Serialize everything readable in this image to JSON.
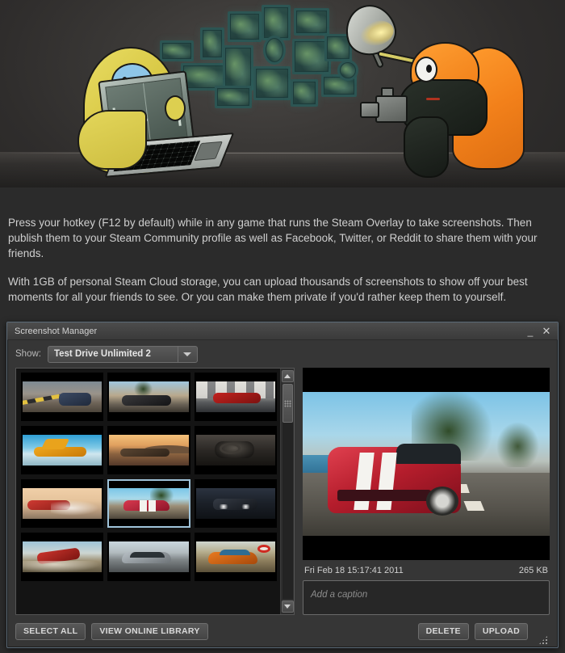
{
  "page": {
    "body_paragraphs": [
      "Press your hotkey (F12 by default) while in any game that runs the Steam Overlay to take screenshots. Then publish them to your Steam Community profile as well as Facebook, Twitter, or Reddit to share them with your friends.",
      "With 1GB of personal Steam Cloud storage, you can upload thousands of screenshots to show off your best moments for all your friends to see. Or you can make them private if you'd rather keep them to yourself."
    ]
  },
  "hero": {
    "alt": "Two blob characters: a yellow one with a laptop and an orange one with a camera and studio light, surrounded by floating picture frames"
  },
  "window": {
    "title": "Screenshot Manager",
    "minimize_label": "_",
    "close_label": "✕",
    "toolbar": {
      "show_label": "Show:",
      "selected_game": "Test Drive Unlimited 2"
    },
    "thumbnails": [
      {
        "id": 1,
        "alt": "Blue sports car on desert road",
        "selected": false
      },
      {
        "id": 2,
        "alt": "Black sports car with palm trees",
        "selected": false
      },
      {
        "id": 3,
        "alt": "Red coupe in front of building",
        "selected": false
      },
      {
        "id": 4,
        "alt": "Orange supercar with doors up",
        "selected": false
      },
      {
        "id": 5,
        "alt": "Convertible at sunset in desert",
        "selected": false
      },
      {
        "id": 6,
        "alt": "Car interior dashboard view",
        "selected": false
      },
      {
        "id": 7,
        "alt": "Red car drifting in dust",
        "selected": false
      },
      {
        "id": 8,
        "alt": "Red Viper with white stripes on coast road",
        "selected": true
      },
      {
        "id": 9,
        "alt": "Dark car with headlights at night",
        "selected": false
      },
      {
        "id": 10,
        "alt": "Red car jumping off road",
        "selected": false
      },
      {
        "id": 11,
        "alt": "Silver coupe on highway",
        "selected": false
      },
      {
        "id": 12,
        "alt": "Orange supercar near road sign",
        "selected": false
      }
    ],
    "scrollbar": {
      "up_arrow": "▲",
      "down_arrow": "▼"
    },
    "preview": {
      "alt": "Red Dodge Viper with white racing stripes driving on a coastal road",
      "timestamp": "Fri Feb 18 15:17:41 2011",
      "file_size": "265 KB",
      "caption_placeholder": "Add a caption",
      "caption_value": ""
    },
    "footer": {
      "select_all_label": "SELECT ALL",
      "view_online_library_label": "VIEW ONLINE LIBRARY",
      "delete_label": "DELETE",
      "upload_label": "UPLOAD"
    }
  },
  "colors": {
    "page_background": "#2b2b2b",
    "window_background": "#363636",
    "window_border": "#5b6a77",
    "selection_border": "#9fc3da",
    "text_primary": "#cfcfcf",
    "text_muted": "#8d8d8d"
  }
}
